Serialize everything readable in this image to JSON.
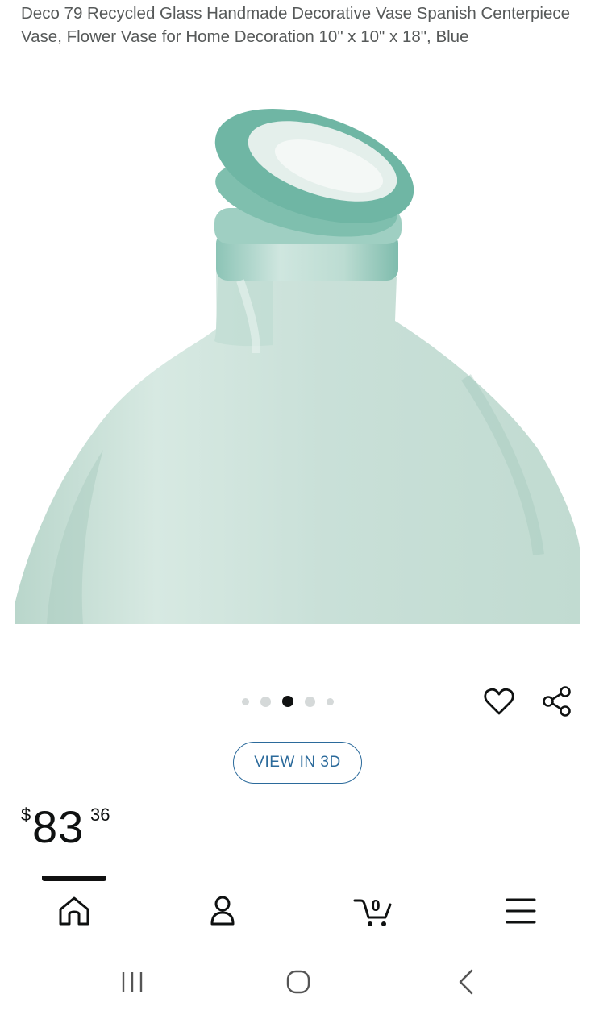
{
  "product": {
    "title": "Deco 79 Recycled Glass Handmade Decorative Vase Spanish Centerpiece Vase, Flower Vase for Home Decoration 10\" x 10\" x 18\", Blue",
    "image": "glass-vase-photo",
    "image_carousel": {
      "count": 5,
      "active_index": 2
    },
    "view_3d_label": "VIEW IN 3D",
    "price": {
      "currency": "$",
      "whole": "83",
      "fraction": "36"
    }
  },
  "icons": {
    "wishlist": "heart-icon",
    "share": "share-icon"
  },
  "bottom_nav": {
    "items": [
      {
        "icon": "home-icon",
        "active": true
      },
      {
        "icon": "account-icon",
        "active": false
      },
      {
        "icon": "cart-icon",
        "badge": "0",
        "active": false
      },
      {
        "icon": "menu-icon",
        "active": false
      }
    ]
  },
  "system_nav": {
    "items": [
      "recent-apps-icon",
      "home-circle-icon",
      "back-icon"
    ]
  },
  "colors": {
    "link": "#2b6a9b",
    "text": "#0f1111",
    "secondary_text": "#565959",
    "glass": "#cfe4dc"
  }
}
